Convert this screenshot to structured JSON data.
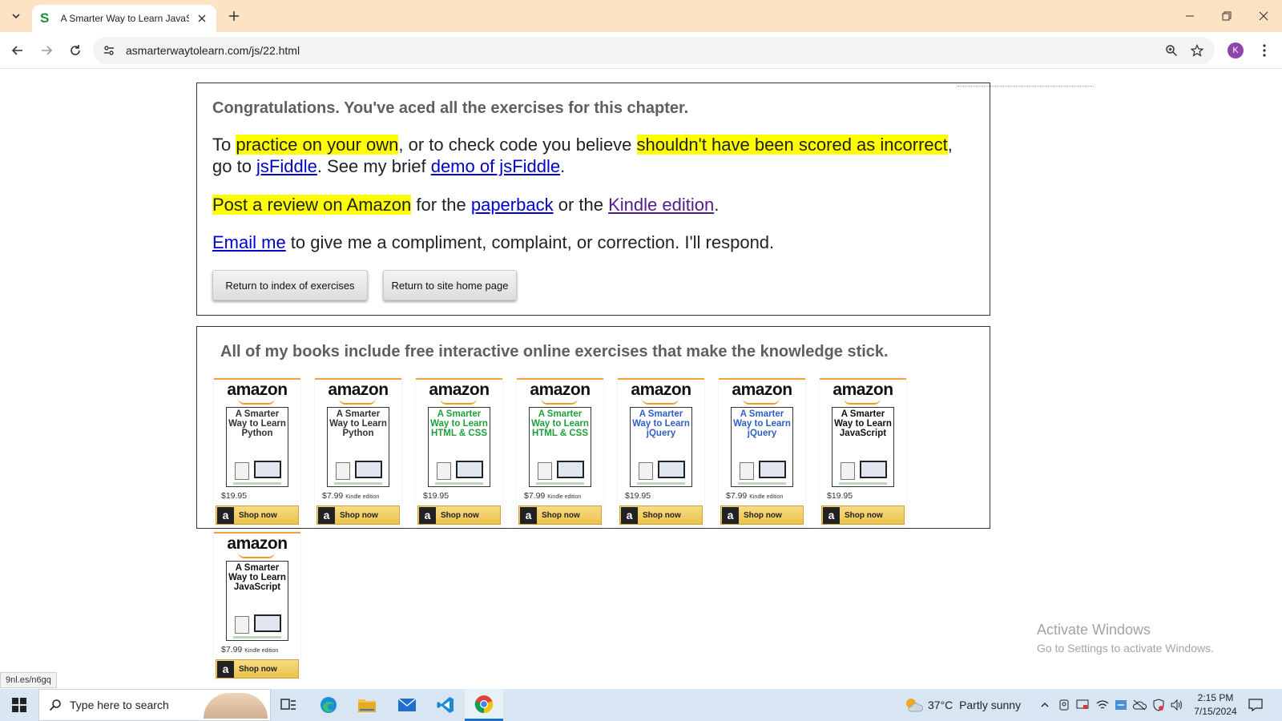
{
  "browser": {
    "tab_title": "A Smarter Way to Learn JavaScr",
    "favicon_letter": "S",
    "url": "asmarterwaytolearn.com/js/22.html",
    "profile_initial": "K"
  },
  "page": {
    "congrats": "Congratulations. You've aced all the exercises for this chapter.",
    "p1": {
      "t1": "To ",
      "hl1": "practice on your own",
      "t2": ", or to check code you believe ",
      "hl2": "shouldn't have been scored as incorrect",
      "t3": ", go to ",
      "link_jsfiddle": "jsFiddle",
      "t4": ". See my brief ",
      "link_demo": "demo of jsFiddle",
      "t5": "."
    },
    "p2": {
      "hl": "Post a review on Amazon",
      "t1": " for the ",
      "link_paperback": "paperback",
      "t2": " or the ",
      "link_kindle": "Kindle edition",
      "t3": "."
    },
    "p3": {
      "link_email": "Email me",
      "t1": " to give me a compliment, complaint, or correction. I'll respond."
    },
    "buttons": {
      "index": "Return to index of exercises",
      "home": "Return to site home page"
    },
    "books_heading": "All of my books include free interactive online exercises that make the knowledge stick."
  },
  "books": [
    {
      "brand": "amazon",
      "title": "A Smarter Way to Learn Python",
      "title_color": "#333333",
      "price": "$19.95",
      "edition": "",
      "shop": "Shop now"
    },
    {
      "brand": "amazon",
      "title": "A Smarter Way to Learn Python",
      "title_color": "#333333",
      "price": "$7.99",
      "edition": "Kindle edition",
      "shop": "Shop now"
    },
    {
      "brand": "amazon",
      "title": "A Smarter Way to Learn HTML & CSS",
      "title_color": "#1e9e3a",
      "price": "$19.95",
      "edition": "",
      "shop": "Shop now"
    },
    {
      "brand": "amazon",
      "title": "A Smarter Way to Learn HTML & CSS",
      "title_color": "#1e9e3a",
      "price": "$7.99",
      "edition": "Kindle edition",
      "shop": "Shop now"
    },
    {
      "brand": "amazon",
      "title": "A Smarter Way to Learn jQuery",
      "title_color": "#2f5fc4",
      "price": "$19.95",
      "edition": "",
      "shop": "Shop now"
    },
    {
      "brand": "amazon",
      "title": "A Smarter Way to Learn jQuery",
      "title_color": "#2f5fc4",
      "price": "$7.99",
      "edition": "Kindle edition",
      "shop": "Shop now"
    },
    {
      "brand": "amazon",
      "title": "A Smarter Way to Learn JavaScript",
      "title_color": "#111111",
      "price": "$19.95",
      "edition": "",
      "shop": "Shop now"
    },
    {
      "brand": "amazon",
      "title": "A Smarter Way to Learn JavaScript",
      "title_color": "#111111",
      "price": "$7.99",
      "edition": "Kindle edition",
      "shop": "Shop now"
    }
  ],
  "overlay": {
    "activate_title": "Activate Windows",
    "activate_sub": "Go to Settings to activate Windows.",
    "status_url": "9nl.es/n6gq"
  },
  "taskbar": {
    "search_placeholder": "Type here to search",
    "weather_temp": "37°C",
    "weather_desc": "Partly sunny",
    "time": "2:15 PM",
    "date": "7/15/2024"
  },
  "colors": {
    "titlebar": "#fde2c4",
    "highlight": "#ffff00",
    "link": "#0000cc",
    "visited_link": "#551a8b",
    "amazon_orange": "#f39a1b"
  }
}
